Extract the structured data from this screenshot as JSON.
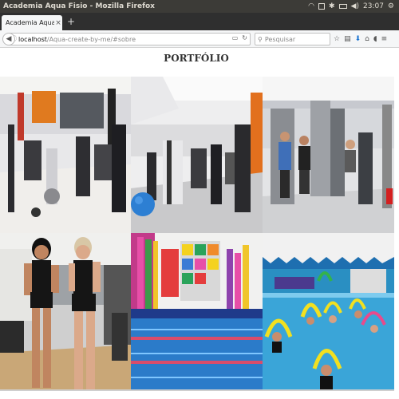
{
  "os": {
    "window_title": "Academia Aqua Fisio - Mozilla Firefox",
    "time": "23:07"
  },
  "browser": {
    "tab_label": "Academia Aqua Fisio",
    "tab_close": "×",
    "new_tab": "+",
    "url_host": "localhost",
    "url_path": "/Aqua-create-by-me/#sobre",
    "search_placeholder": "Pesquisar"
  },
  "page": {
    "title": "PORTFÓLIO"
  },
  "gallery": {
    "photos": [
      {
        "name": "gym-photo-1"
      },
      {
        "name": "gym-photo-2"
      },
      {
        "name": "gym-photo-3"
      },
      {
        "name": "trainers-photo"
      },
      {
        "name": "pool-equipment-photo"
      },
      {
        "name": "aqua-class-photo"
      }
    ]
  },
  "colors": {
    "os_bar": "#3c3b37",
    "tab_strip": "#2f2f2f",
    "toolbar": "#f5f6f7",
    "accent_blue": "#1a74d1"
  }
}
